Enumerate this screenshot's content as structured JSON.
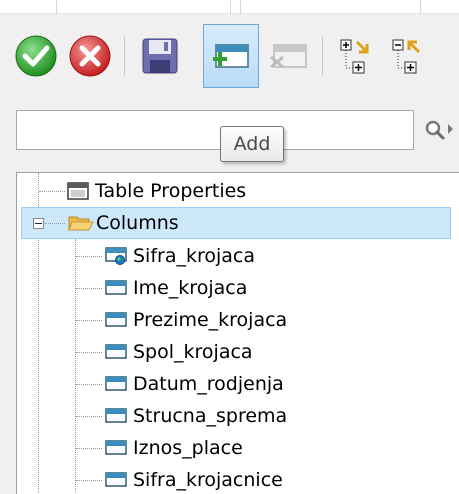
{
  "toolbar": {
    "buttons": [
      {
        "name": "accept",
        "icon": "check-icon"
      },
      {
        "name": "cancel",
        "icon": "x-icon"
      },
      {
        "name": "save",
        "icon": "save-icon"
      },
      {
        "name": "add",
        "icon": "add-column-icon",
        "active": true
      },
      {
        "name": "remove",
        "icon": "remove-column-icon",
        "disabled": true
      },
      {
        "name": "expand-all",
        "icon": "expand-all-icon"
      },
      {
        "name": "collapse-all",
        "icon": "collapse-all-icon"
      }
    ],
    "tooltip": "Add"
  },
  "search": {
    "value": "",
    "placeholder": ""
  },
  "tree": {
    "root_items": [
      {
        "label": "Table Properties",
        "icon": "table-icon"
      },
      {
        "label": "Columns",
        "icon": "folder-open-icon",
        "expanded": true,
        "selected": true
      }
    ],
    "columns": [
      {
        "label": "Sifra_krojaca",
        "icon": "primary-key-column-icon"
      },
      {
        "label": "Ime_krojaca",
        "icon": "column-icon"
      },
      {
        "label": "Prezime_krojaca",
        "icon": "column-icon"
      },
      {
        "label": "Spol_krojaca",
        "icon": "column-icon"
      },
      {
        "label": "Datum_rodjenja",
        "icon": "column-icon"
      },
      {
        "label": "Strucna_sprema",
        "icon": "column-icon"
      },
      {
        "label": "Iznos_place",
        "icon": "column-icon"
      },
      {
        "label": "Sifra_krojacnice",
        "icon": "column-icon"
      }
    ]
  },
  "colors": {
    "selection_bg": "#cde8fb",
    "selection_border": "#99d1f6",
    "active_button_bg": "#c5e2f8",
    "accept_green": "#3aa53a",
    "cancel_red": "#d63a3a"
  }
}
